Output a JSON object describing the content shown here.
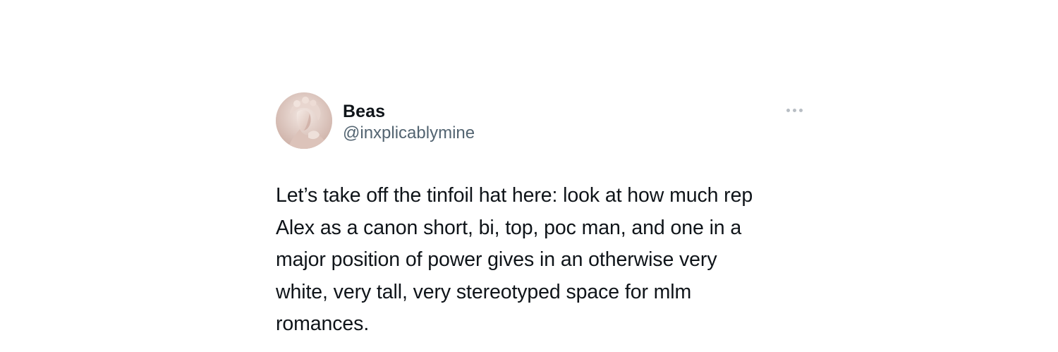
{
  "tweet": {
    "author": {
      "display_name": "Beas",
      "handle": "@inxplicablymine",
      "avatar_icon": "statue-avatar"
    },
    "more_icon": "more-options-icon",
    "text_lines": [
      "Let’s take off the tinfoil hat here: look at how much rep",
      "Alex as a canon short, bi, top, poc man, and one in a",
      "major position of power gives in an otherwise very",
      "white, very tall, very stereotyped space for mlm",
      "romances."
    ]
  },
  "colors": {
    "text_primary": "#0f1419",
    "text_secondary": "#536471",
    "icon_muted": "#b8bec4",
    "background": "#ffffff"
  }
}
